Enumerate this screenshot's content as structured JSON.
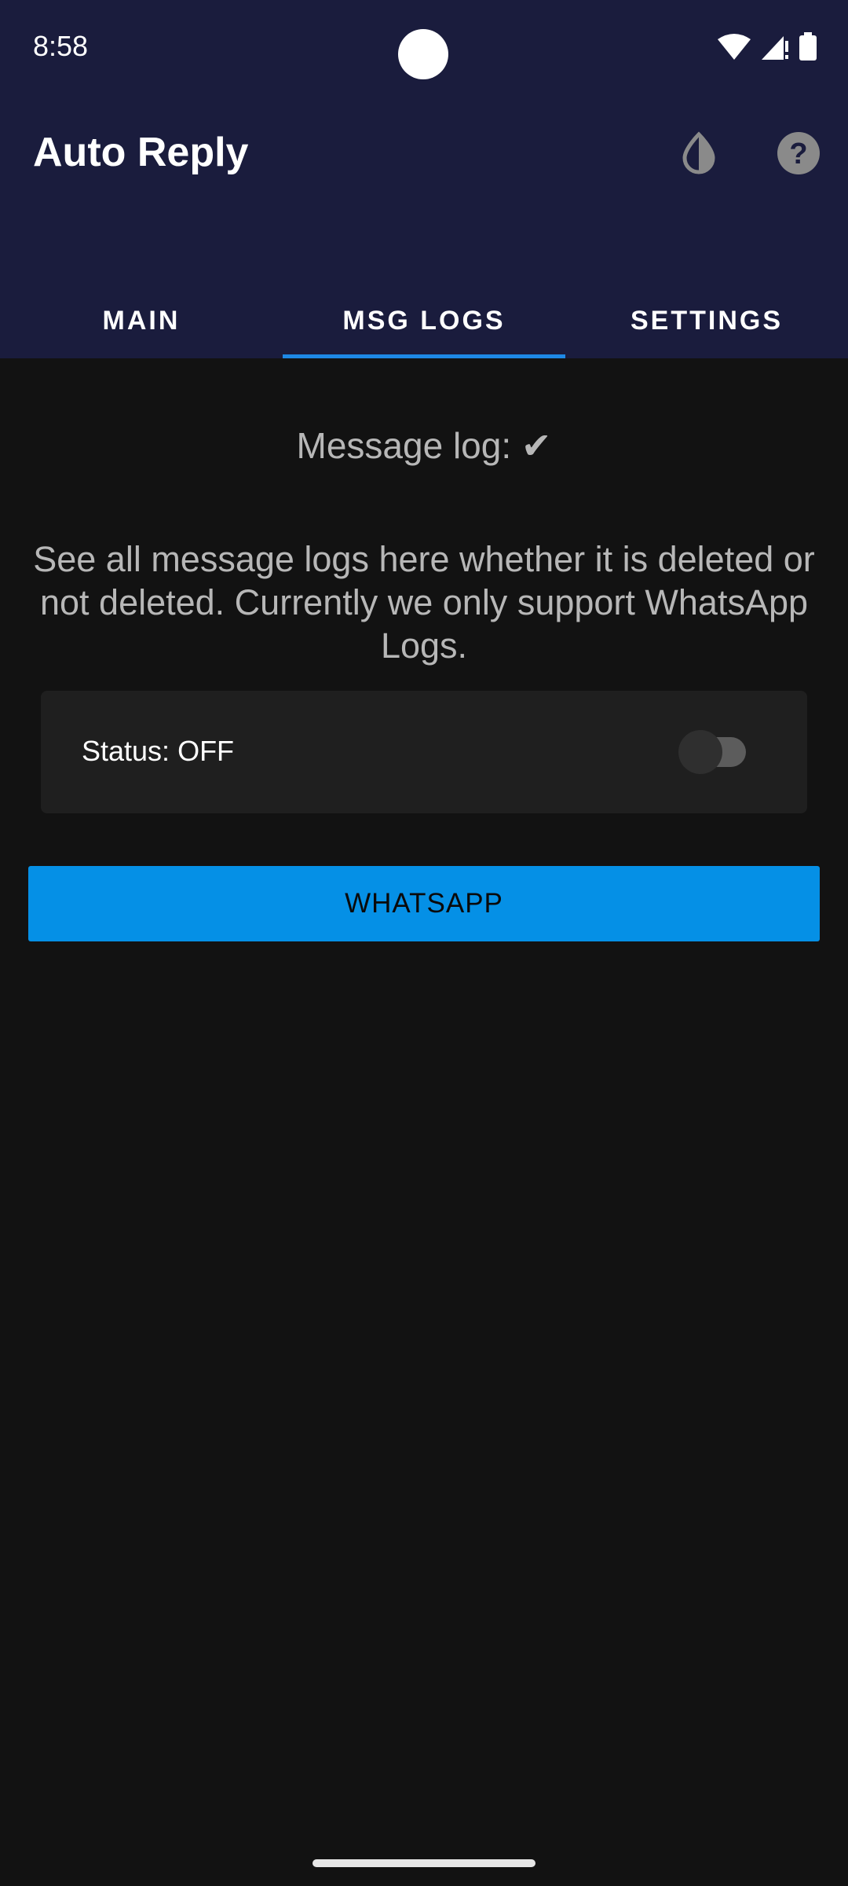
{
  "status_bar": {
    "time": "8:58",
    "icons": [
      "wifi-icon",
      "signal-icon",
      "battery-icon"
    ]
  },
  "app_bar": {
    "title": "Auto Reply",
    "actions": [
      "theme-icon",
      "help-icon"
    ]
  },
  "tabs": [
    {
      "label": "MAIN",
      "selected": false
    },
    {
      "label": "MSG LOGS",
      "selected": true
    },
    {
      "label": "SETTINGS",
      "selected": false
    }
  ],
  "content": {
    "heading": "Message log: ✔",
    "description": "See all message logs here whether it is deleted or not deleted. Currently we only support WhatsApp Logs.",
    "status_label": "Status: OFF",
    "status_enabled": false,
    "button_label": "WHATSAPP"
  },
  "colors": {
    "app_bar": "#1a1c3d",
    "background": "#121212",
    "accent": "#1e88e5",
    "button": "#0590e6"
  }
}
